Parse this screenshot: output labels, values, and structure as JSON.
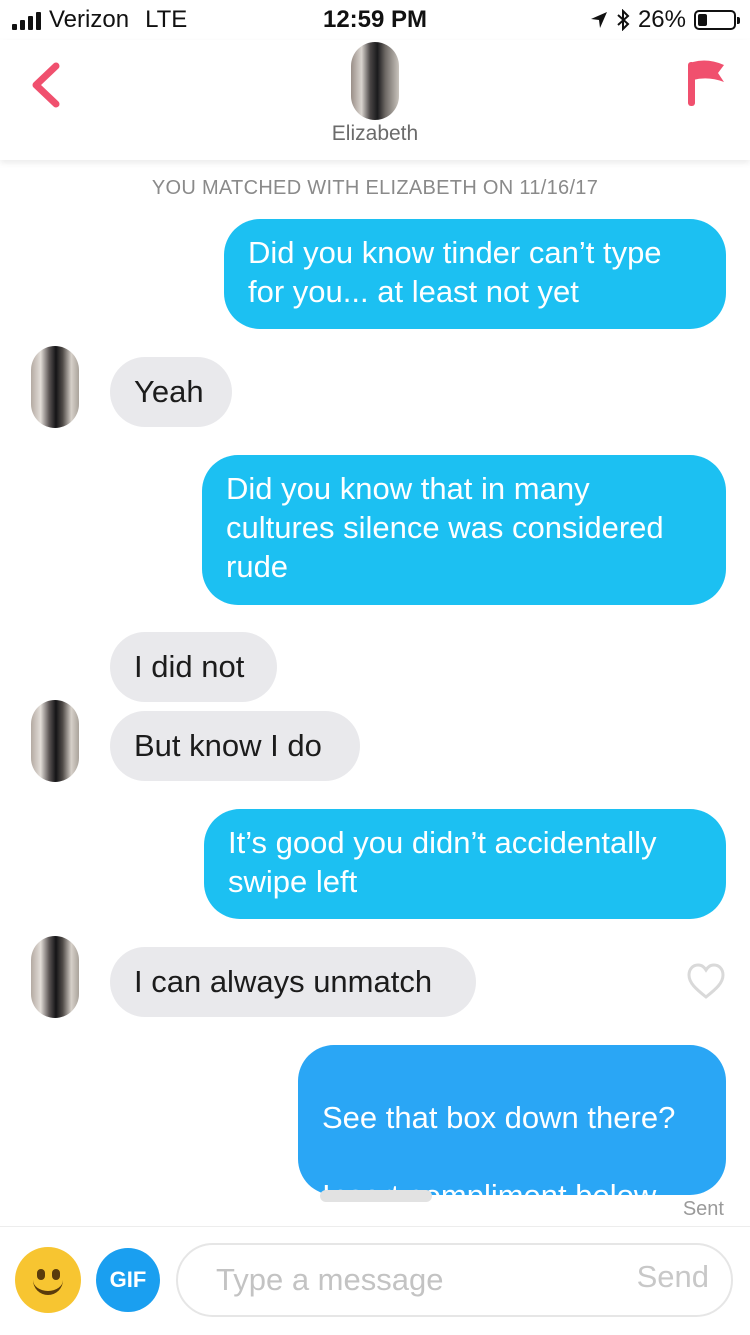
{
  "status_bar": {
    "carrier": "Verizon",
    "network": "LTE",
    "time": "12:59 PM",
    "battery_text": "26%",
    "battery_level": 0.26
  },
  "header": {
    "match_name": "Elizabeth",
    "accent_color": "#f0506e"
  },
  "match_note": "YOU MATCHED WITH ELIZABETH ON 11/16/17",
  "messages": [
    {
      "sender": "me",
      "text": "Did you know tinder can’t type for you... at least not yet"
    },
    {
      "sender": "match",
      "text": "Yeah"
    },
    {
      "sender": "me",
      "text": "Did you know that in many cultures silence was considered rude"
    },
    {
      "sender": "match",
      "text": "I did not"
    },
    {
      "sender": "match",
      "text": "But know I do"
    },
    {
      "sender": "me",
      "text": "It’s good you didn’t accidentally swipe left"
    },
    {
      "sender": "match",
      "text": "I can always unmatch"
    },
    {
      "sender": "me",
      "text": "See that box down there?\n\nInsert compliment below"
    }
  ],
  "sent_label": "Sent",
  "composer": {
    "gif_label": "GIF",
    "input_placeholder": "Type a message",
    "input_value": "",
    "send_label": "Send"
  },
  "icons": [
    "back-chevron-icon",
    "flag-icon",
    "heart-icon",
    "smiley-icon"
  ]
}
